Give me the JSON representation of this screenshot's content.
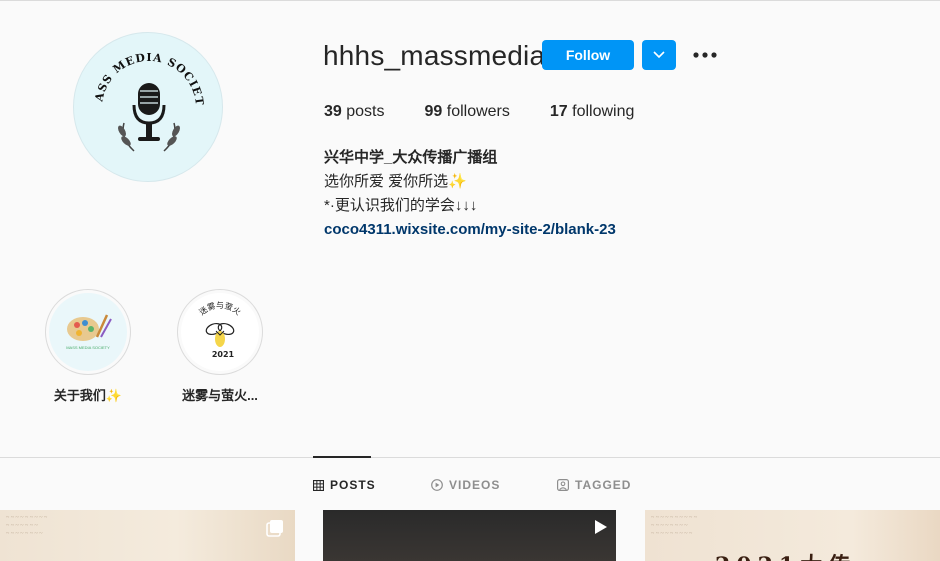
{
  "profile": {
    "username": "hhhs_massmedia",
    "avatar_text": "MASS MEDIA SOCIETY",
    "follow_label": "Follow",
    "stats": {
      "posts_count": "39",
      "posts_label": "posts",
      "followers_count": "99",
      "followers_label": "followers",
      "following_count": "17",
      "following_label": "following"
    },
    "bio": {
      "name": "兴华中学_大众传播广播组",
      "line1": "选你所爱 爱你所选✨",
      "line2": "*·更认识我们的学会↓↓↓",
      "link": "coco4311.wixsite.com/my-site-2/blank-23"
    }
  },
  "highlights": [
    {
      "label": "关于我们✨",
      "art_text": "MASS MEDIA SOCIETY",
      "icon": "palette-icon"
    },
    {
      "label": "迷雾与萤火...",
      "art_text": "迷雾与萤火",
      "year": "2021",
      "icon": "firefly-icon"
    }
  ],
  "tabs": [
    {
      "label": "POSTS",
      "icon": "grid-icon",
      "active": true
    },
    {
      "label": "VIDEOS",
      "icon": "play-circle-icon",
      "active": false
    },
    {
      "label": "TAGGED",
      "icon": "tag-icon",
      "active": false
    }
  ],
  "posts": [
    {
      "type": "carousel",
      "icon": "carousel-icon"
    },
    {
      "type": "video",
      "icon": "play-icon"
    },
    {
      "type": "image",
      "title": "2021大传..."
    }
  ],
  "colors": {
    "primary": "#0095f6",
    "text": "#262626",
    "muted": "#8e8e8e",
    "link": "#00376b"
  }
}
